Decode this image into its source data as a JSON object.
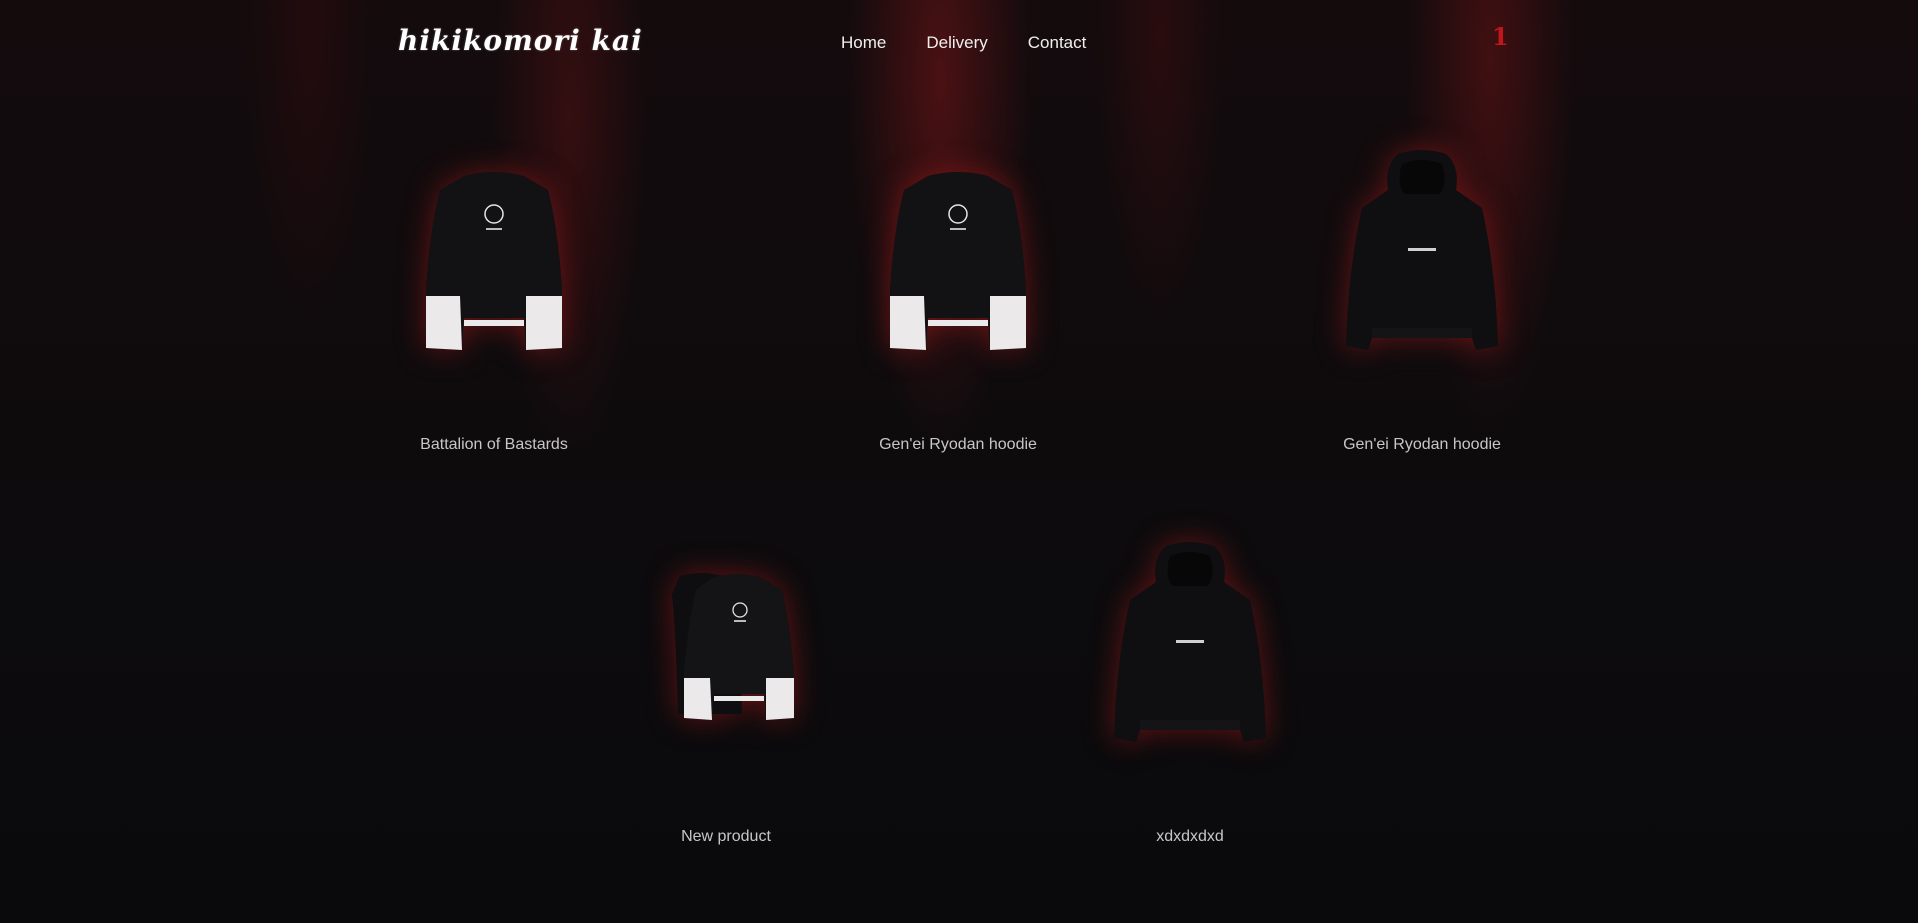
{
  "brand": {
    "logo_text": "hikikomori kai"
  },
  "nav": {
    "items": [
      {
        "label": "Home"
      },
      {
        "label": "Delivery"
      },
      {
        "label": "Contact"
      }
    ]
  },
  "cart": {
    "count": "1",
    "accent": "#c4161a"
  },
  "products": [
    {
      "name": "Battalion of Bastards",
      "image_icon": "longsleeve-white-cuffs-icon"
    },
    {
      "name": "Gen'ei Ryodan hoodie",
      "image_icon": "longsleeve-white-cuffs-icon"
    },
    {
      "name": "Gen'ei Ryodan hoodie",
      "image_icon": "black-hoodie-icon"
    },
    {
      "name": "New product",
      "image_icon": "longsleeve-pair-icon"
    },
    {
      "name": "xdxdxdxd",
      "image_icon": "black-hoodie-icon"
    }
  ],
  "colors": {
    "background": "#0b0a0c",
    "glow": "#a0181c"
  }
}
